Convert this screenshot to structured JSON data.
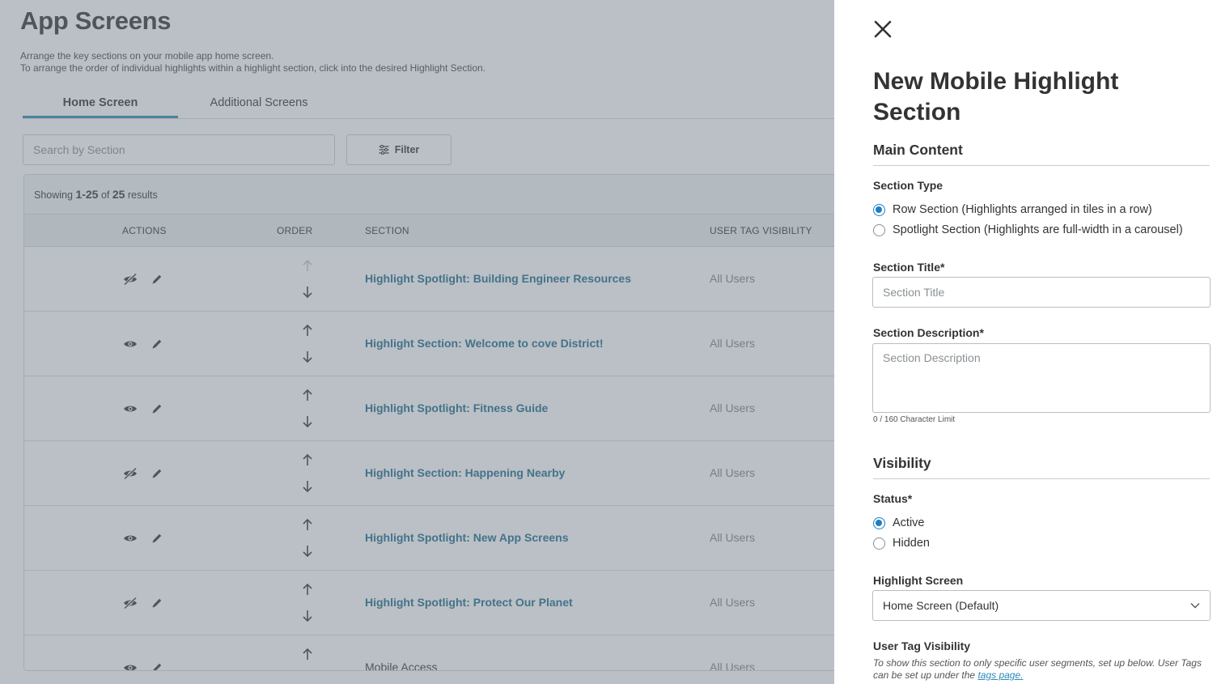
{
  "page": {
    "title": "App Screens",
    "description_line1": "Arrange the key sections on your mobile app home screen.",
    "description_line2": "To arrange the order of individual highlights within a highlight section, click into the desired Highlight Section."
  },
  "tabs": [
    {
      "label": "Home Screen",
      "active": true
    },
    {
      "label": "Additional Screens",
      "active": false
    }
  ],
  "search": {
    "placeholder": "Search by Section"
  },
  "filter": {
    "label": "Filter"
  },
  "results": {
    "prefix": "Showing ",
    "range": "1-25",
    "of": " of ",
    "total": "25",
    "suffix": " results"
  },
  "table": {
    "headers": {
      "actions": "ACTIONS",
      "order": "ORDER",
      "section": "SECTION",
      "user_tag": "USER TAG VISIBILITY"
    },
    "rows": [
      {
        "section": "Highlight Spotlight: Building Engineer Resources",
        "user_tag": "All Users",
        "visibility_icon": "eye-slash-icon",
        "is_link": true
      },
      {
        "section": "Highlight Section: Welcome to cove District!",
        "user_tag": "All Users",
        "visibility_icon": "eye-icon",
        "is_link": true
      },
      {
        "section": "Highlight Spotlight: Fitness Guide",
        "user_tag": "All Users",
        "visibility_icon": "eye-icon",
        "is_link": true
      },
      {
        "section": "Highlight Section: Happening Nearby",
        "user_tag": "All Users",
        "visibility_icon": "eye-slash-icon",
        "is_link": true
      },
      {
        "section": "Highlight Spotlight: New App Screens",
        "user_tag": "All Users",
        "visibility_icon": "eye-icon",
        "is_link": true
      },
      {
        "section": "Highlight Spotlight: Protect Our Planet",
        "user_tag": "All Users",
        "visibility_icon": "eye-slash-icon",
        "is_link": true
      },
      {
        "section": "Mobile Access",
        "user_tag": "All Users",
        "visibility_icon": "eye-icon",
        "is_link": false
      }
    ]
  },
  "panel": {
    "title": "New Mobile Highlight Section",
    "main_content_heading": "Main Content",
    "section_type_label": "Section Type",
    "section_type_options": [
      {
        "label": "Row Section (Highlights arranged in tiles in a row)",
        "checked": true
      },
      {
        "label": "Spotlight Section (Highlights are full-width in a carousel)",
        "checked": false
      }
    ],
    "section_title_label": "Section Title*",
    "section_title_placeholder": "Section Title",
    "section_description_label": "Section Description*",
    "section_description_placeholder": "Section Description",
    "char_limit": "0 / 160 Character Limit",
    "visibility_heading": "Visibility",
    "status_label": "Status*",
    "status_options": [
      {
        "label": "Active",
        "checked": true
      },
      {
        "label": "Hidden",
        "checked": false
      }
    ],
    "highlight_screen_label": "Highlight Screen",
    "highlight_screen_value": "Home Screen (Default)",
    "user_tag_label": "User Tag Visibility",
    "user_tag_help": "To show this section to only specific user segments, set up below. User Tags can be set up under the ",
    "user_tag_link": "tags page."
  },
  "colors": {
    "accent": "#2b8ab9",
    "link": "#1e6a8e",
    "radio": "#1e7fc4",
    "overlay": "#6e7b86"
  }
}
